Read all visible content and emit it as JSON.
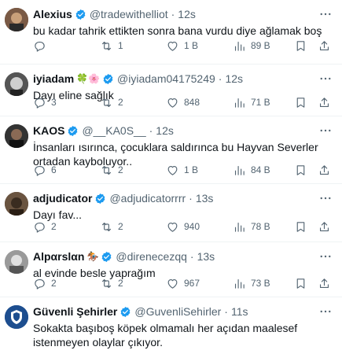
{
  "tweets": [
    {
      "name": "Alexius",
      "verified": true,
      "emoji": "",
      "handle": "@tradewithelliot",
      "dot": "·",
      "time": "12s",
      "text": "bu kadar tahrik ettikten sonra bana vurdu diye ağlamak boş",
      "replies": "",
      "retweets": "1",
      "likes": "1 B",
      "views": "89 B",
      "avatar_color": "#6b4a3a"
    },
    {
      "name": "iyiadam",
      "verified": true,
      "emoji": "🍀🌸",
      "handle": "@iyiadam04175249",
      "dot": "·",
      "time": "12s",
      "text": "Dayı eline sağlık",
      "replies": "3",
      "retweets": "2",
      "likes": "848",
      "views": "71 B",
      "avatar_color": "#3d3d3d"
    },
    {
      "name": "KAOS",
      "verified": true,
      "emoji": "",
      "handle": "@__KA0S__",
      "dot": "·",
      "time": "12s",
      "text": "İnsanları ısırınca, çocuklara saldırınca bu Hayvan Severler ortadan kayboluyor..",
      "replies": "6",
      "retweets": "2",
      "likes": "1 B",
      "views": "84 B",
      "avatar_color": "#2c2c2c"
    },
    {
      "name": "adjudicator",
      "verified": true,
      "emoji": "",
      "handle": "@adjudicatorrrr",
      "dot": "·",
      "time": "13s",
      "text": "Dayı fav...",
      "replies": "2",
      "retweets": "2",
      "likes": "940",
      "views": "78 B",
      "avatar_color": "#5a4632"
    },
    {
      "name": "Alpαrslαn",
      "verified": true,
      "emoji": "🏇",
      "handle": "@direnecezqq",
      "dot": "·",
      "time": "13s",
      "text": "al evinde besle yaprağım",
      "replies": "2",
      "retweets": "2",
      "likes": "967",
      "views": "73 B",
      "avatar_color": "#8a8a8a"
    },
    {
      "name": "Güvenli Şehirler",
      "verified": true,
      "emoji": "",
      "handle": "@GuvenliSehirler",
      "dot": "·",
      "time": "11s",
      "text": "Sokakta başıboş köpek olmamalı her açıdan maalesef istenmeyen olaylar çıkıyor.",
      "replies": "",
      "retweets": "",
      "likes": "",
      "views": "",
      "avatar_color": "#1d4e8f"
    }
  ],
  "colors": {
    "verified": "#1d9bf0",
    "secondary_text": "#536471",
    "border": "#eff3f4"
  }
}
